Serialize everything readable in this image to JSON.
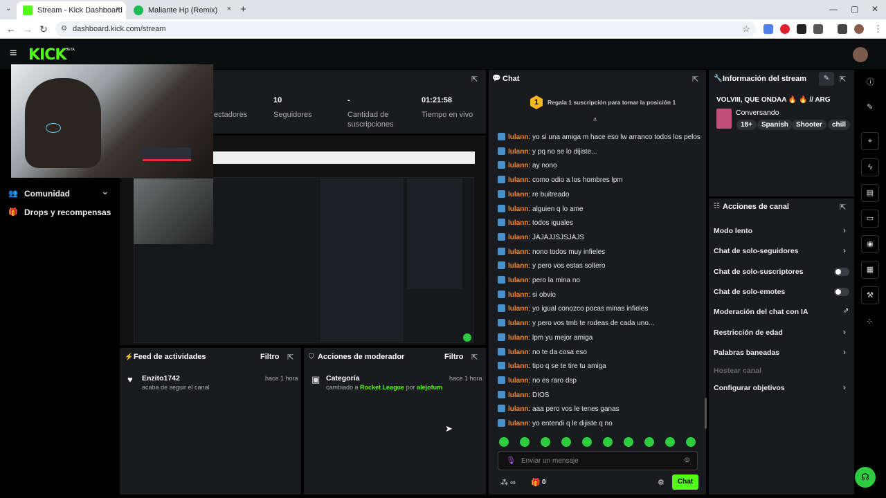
{
  "browser": {
    "tabs": [
      {
        "title": "Stream - Kick Dashboard",
        "close": "×"
      },
      {
        "title": "Maliante Hp (Remix) [feat. /",
        "close": "×"
      }
    ],
    "new_tab": "+",
    "url": "dashboard.kick.com/stream",
    "back": "←",
    "forward": "→",
    "reload": "↻",
    "star": "☆",
    "win_min": "—",
    "win_max": "▢",
    "win_close": "✕"
  },
  "kick": {
    "logo": "KICK",
    "beta": "BETA",
    "menu": "≡"
  },
  "stats": [
    {
      "value": "",
      "label": "ectadores"
    },
    {
      "value": "10",
      "label": "Seguidores"
    },
    {
      "value": "-",
      "label": "Cantidad de suscripciones"
    },
    {
      "value": "01:21:58",
      "label": "Tiempo en vivo"
    }
  ],
  "sidebar": {
    "community": "Comunidad",
    "drops": "Drops y recompensas",
    "chevron": "⌄"
  },
  "activity_feed": {
    "title": "Feed de actividades",
    "filter": "Filtro",
    "items": [
      {
        "user": "Enzito1742",
        "text": "acaba de seguir el canal",
        "time": "hace 1 hora"
      }
    ]
  },
  "mod_actions": {
    "title": "Acciones de moderador",
    "filter": "Filtro",
    "items": [
      {
        "title": "Categoría",
        "text_prefix": "cambiado a",
        "category": "Rocket League",
        "by": "por",
        "user": "alejofum",
        "time": "hace 1 hora"
      }
    ]
  },
  "chat": {
    "title": "Chat",
    "gift_count": "1",
    "gift_text": "Regala 1 suscripción para tomar la posición 1",
    "messages": [
      {
        "user": "lulann",
        "text": "yo si una amiga m hace eso lw arranco todos los pelos"
      },
      {
        "user": "lulann",
        "text": "y pq no se lo dijiste..."
      },
      {
        "user": "lulann",
        "text": "ay nono"
      },
      {
        "user": "lulann",
        "text": "como odio a los hombres lpm"
      },
      {
        "user": "lulann",
        "text": "re buitreado"
      },
      {
        "user": "lulann",
        "text": "alguien q lo ame"
      },
      {
        "user": "lulann",
        "text": "todos iguales"
      },
      {
        "user": "lulann",
        "text": "JAJAJJSJSJAJS"
      },
      {
        "user": "lulann",
        "text": "nono todos muy infieles"
      },
      {
        "user": "lulann",
        "text": "y pero vos estas soltero"
      },
      {
        "user": "lulann",
        "text": "pero la mina no"
      },
      {
        "user": "lulann",
        "text": "si obvio"
      },
      {
        "user": "lulann",
        "text": "yo igual conozco pocas minas infieles"
      },
      {
        "user": "lulann",
        "text": "y pero vos tmb te rodeas de cada uno..."
      },
      {
        "user": "lulann",
        "text": "lpm yu mejor amiga"
      },
      {
        "user": "lulann",
        "text": "no te da cosa eso"
      },
      {
        "user": "lulann",
        "text": "tipo q se te tire tu amiga"
      },
      {
        "user": "lulann",
        "text": "no es raro dsp"
      },
      {
        "user": "lulann",
        "text": "DIOS"
      },
      {
        "user": "lulann",
        "text": "aaa pero vos le tenes ganas"
      },
      {
        "user": "lulann",
        "text": "yo entendi q le dijiste q no"
      }
    ],
    "placeholder": "Enviar un mensaje",
    "points": "0",
    "send": "Chat"
  },
  "stream_info": {
    "title": "Información del stream",
    "stream_title": "VOLVIII, QUE ONDAA 🔥 🔥 // ARG",
    "category": "Conversando",
    "tags": [
      "18+",
      "Spanish",
      "Shooter",
      "chill"
    ]
  },
  "channel_actions": {
    "title": "Acciones de canal",
    "items": [
      {
        "label": "Modo lento",
        "control": "chevron"
      },
      {
        "label": "Chat de solo-seguidores",
        "control": "chevron"
      },
      {
        "label": "Chat de solo-suscriptores",
        "control": "toggle"
      },
      {
        "label": "Chat de solo-emotes",
        "control": "toggle"
      },
      {
        "label": "Moderación del chat con IA",
        "control": "external"
      },
      {
        "label": "Restricción de edad",
        "control": "chevron"
      },
      {
        "label": "Palabras baneadas",
        "control": "chevron"
      },
      {
        "label": "Hostear canal",
        "control": "none"
      },
      {
        "label": "Configurar objetivos",
        "control": "chevron"
      }
    ]
  },
  "colors": {
    "accent": "#53fc18",
    "panel": "#191b1f",
    "username": "#f08a2c"
  }
}
